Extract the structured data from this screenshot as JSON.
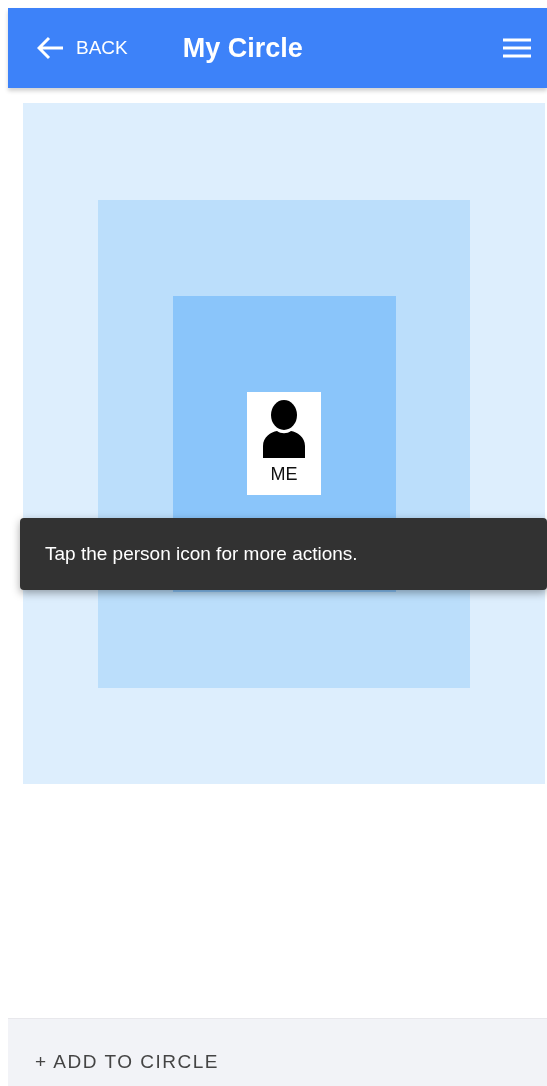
{
  "header": {
    "back_label": "BACK",
    "title": "My Circle"
  },
  "member": {
    "label": "ME"
  },
  "toast": {
    "message": "Tap the person icon for more actions."
  },
  "footer": {
    "action": "+ ADD TO CIRCLE"
  }
}
